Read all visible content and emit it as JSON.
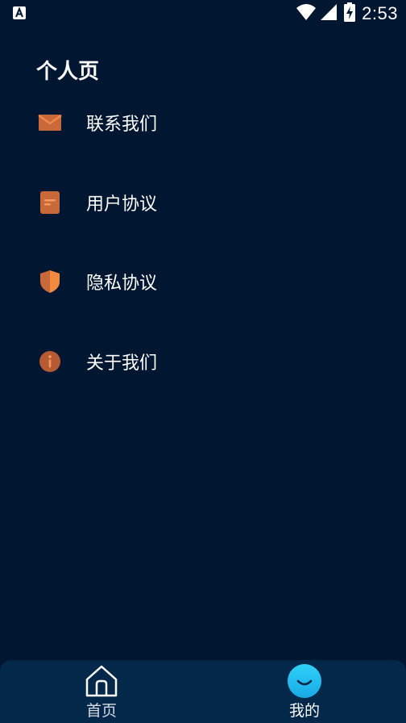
{
  "status_bar": {
    "time": "2:53",
    "notification_icon": "keyboard-a-icon",
    "wifi_icon": "wifi-icon",
    "signal_icon": "cell-signal-icon",
    "battery_icon": "battery-charging-icon"
  },
  "page_title": "个人页",
  "menu": {
    "items": [
      {
        "label": "联系我们",
        "icon": "mail-icon"
      },
      {
        "label": "用户协议",
        "icon": "document-icon"
      },
      {
        "label": "隐私协议",
        "icon": "shield-icon"
      },
      {
        "label": "关于我们",
        "icon": "info-icon"
      }
    ]
  },
  "bottom_nav": {
    "items": [
      {
        "label": "首页",
        "icon": "home-icon"
      },
      {
        "label": "我的",
        "icon": "smile-icon"
      }
    ]
  },
  "colors": {
    "background": "#001631",
    "nav_background": "#04284a",
    "icon_accent": "#d8733a",
    "active_accent": "#29c6f2"
  }
}
